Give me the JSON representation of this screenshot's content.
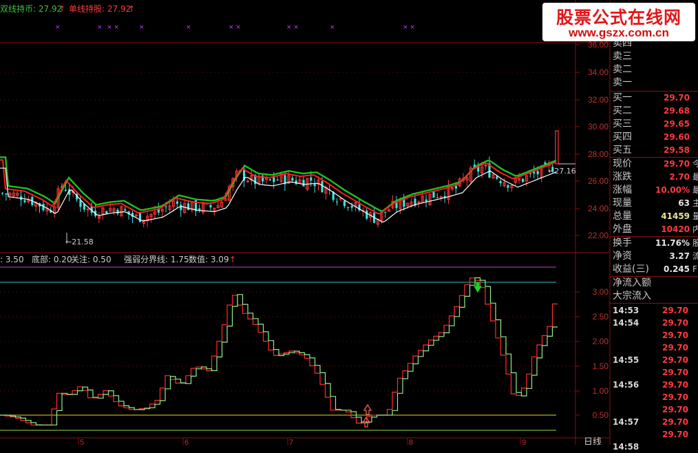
{
  "top_legend": {
    "double_line_label": "双线持币: 27.92",
    "double_line_arrow": "↑",
    "single_line_label": "单线持股: 27.92",
    "single_line_arrow": "↑"
  },
  "indicator_legend": {
    "prefix": ": 3.50",
    "bottom": "底部: 0.20",
    "focus": "关注: 0.50",
    "divider": "强弱分界线: 1.75",
    "value": "数值: 3.09",
    "arrow": "↑"
  },
  "price_axis": [
    "36.00",
    "34.00",
    "32.00",
    "30.00",
    "28.00",
    "26.00",
    "24.00",
    "22.00"
  ],
  "indicator_axis": [
    "3.00",
    "2.50",
    "2.00",
    "1.50",
    "1.00",
    "0.50"
  ],
  "date_labels": [
    "5",
    "6",
    "7",
    "8",
    "9"
  ],
  "period_label": "日线",
  "annotations": {
    "low": "←21.58",
    "last": "←27.16"
  },
  "order_book": {
    "sell": [
      {
        "label": "卖四",
        "value": ""
      },
      {
        "label": "卖三",
        "value": ""
      },
      {
        "label": "卖二",
        "value": ""
      },
      {
        "label": "卖一",
        "value": ""
      }
    ],
    "buy": [
      {
        "label": "买一",
        "value": "29.70"
      },
      {
        "label": "买二",
        "value": "29.68"
      },
      {
        "label": "买三",
        "value": "29.65"
      },
      {
        "label": "买四",
        "value": "29.60"
      },
      {
        "label": "买五",
        "value": "29.58"
      }
    ]
  },
  "quote": [
    {
      "label": "现价",
      "value": "29.70",
      "suffix": "今",
      "color": "#ff3b3b"
    },
    {
      "label": "涨跌",
      "value": "2.70",
      "suffix": "最",
      "color": "#ff3b3b"
    },
    {
      "label": "涨幅",
      "value": "10.00%",
      "suffix": "最",
      "color": "#ff3b3b"
    },
    {
      "label": "现量",
      "value": "63",
      "suffix": "主",
      "color": "#e6e6e6"
    },
    {
      "label": "总量",
      "value": "41459",
      "suffix": "量",
      "color": "#f0e68c"
    },
    {
      "label": "外盘",
      "value": "10420",
      "suffix": "内",
      "color": "#ff3b3b"
    }
  ],
  "stats": [
    {
      "label": "换手",
      "value": "11.76%",
      "suffix": "股",
      "color": "#e6e6e6"
    },
    {
      "label": "净资",
      "value": "3.27",
      "suffix": "流",
      "color": "#e6e6e6"
    },
    {
      "label": "收益(三)",
      "value": "0.245",
      "suffix": "F",
      "color": "#e6e6e6"
    }
  ],
  "flow": [
    "净流入额",
    "大宗流入"
  ],
  "ticks": [
    {
      "time": "14:53",
      "price": "29.70"
    },
    {
      "time": "14:54",
      "price": "29.70"
    },
    {
      "time": "",
      "price": "29.70"
    },
    {
      "time": "",
      "price": "29.70"
    },
    {
      "time": "14:55",
      "price": "29.70"
    },
    {
      "time": "",
      "price": "29.70"
    },
    {
      "time": "14:56",
      "price": "29.70"
    },
    {
      "time": "",
      "price": "29.70"
    },
    {
      "time": "",
      "price": "29.70"
    },
    {
      "time": "14:57",
      "price": "29.70"
    },
    {
      "time": "",
      "price": "29.70"
    },
    {
      "time": "14:58",
      "price": ""
    }
  ],
  "watermark": {
    "title": "股票公式在线网",
    "url": "www.gszx.com.cn"
  },
  "colors": {
    "up": "#ff3b3b",
    "down": "#40e0e0",
    "ma_fast": "#ff2020",
    "ma_slow": "#20c020",
    "ma_white": "#ffffff",
    "axis_frame": "#a01010"
  }
}
